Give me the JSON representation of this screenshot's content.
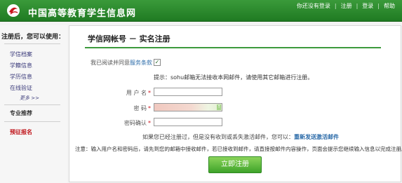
{
  "header": {
    "site_title": "中国高等教育学生信息网",
    "status_text": "你还没有登录",
    "nav": [
      "注册",
      "登录",
      "帮助"
    ]
  },
  "sidebar": {
    "heading": "注册后，您可以使用：",
    "items": [
      "学信档案",
      "学籍信息",
      "学历信息",
      "在线验证"
    ],
    "more": "更多 >>",
    "recommend": "专业推荐",
    "signup": "预征报名"
  },
  "panel": {
    "title": "学信网帐号 － 实名注册",
    "agree_label": "我已阅读并同意",
    "terms_link": "服务条款",
    "hint": "提示：sohu邮箱无法接收本网邮件，请使用其它邮箱进行注册。",
    "username_label": "用 户 名",
    "password_label": "密  码",
    "confirm_label": "密码确认",
    "resend_text": "如果您已经注册过，但是没有收到或丢失激活邮件，您可以：",
    "resend_link": "重新发送激活邮件",
    "note": "注意：输入用户名和密码后，请先到您的邮箱中接收邮件，若已接收到邮件，请直接按邮件内容操作，页面会提示您继续输入信息以完成注册。",
    "submit_label": "立即注册"
  },
  "colors": {
    "header_green": "#2a8a2a",
    "accent_green": "#3c9a3c",
    "link_blue": "#2a6aa8",
    "required_red": "#d0121a"
  }
}
